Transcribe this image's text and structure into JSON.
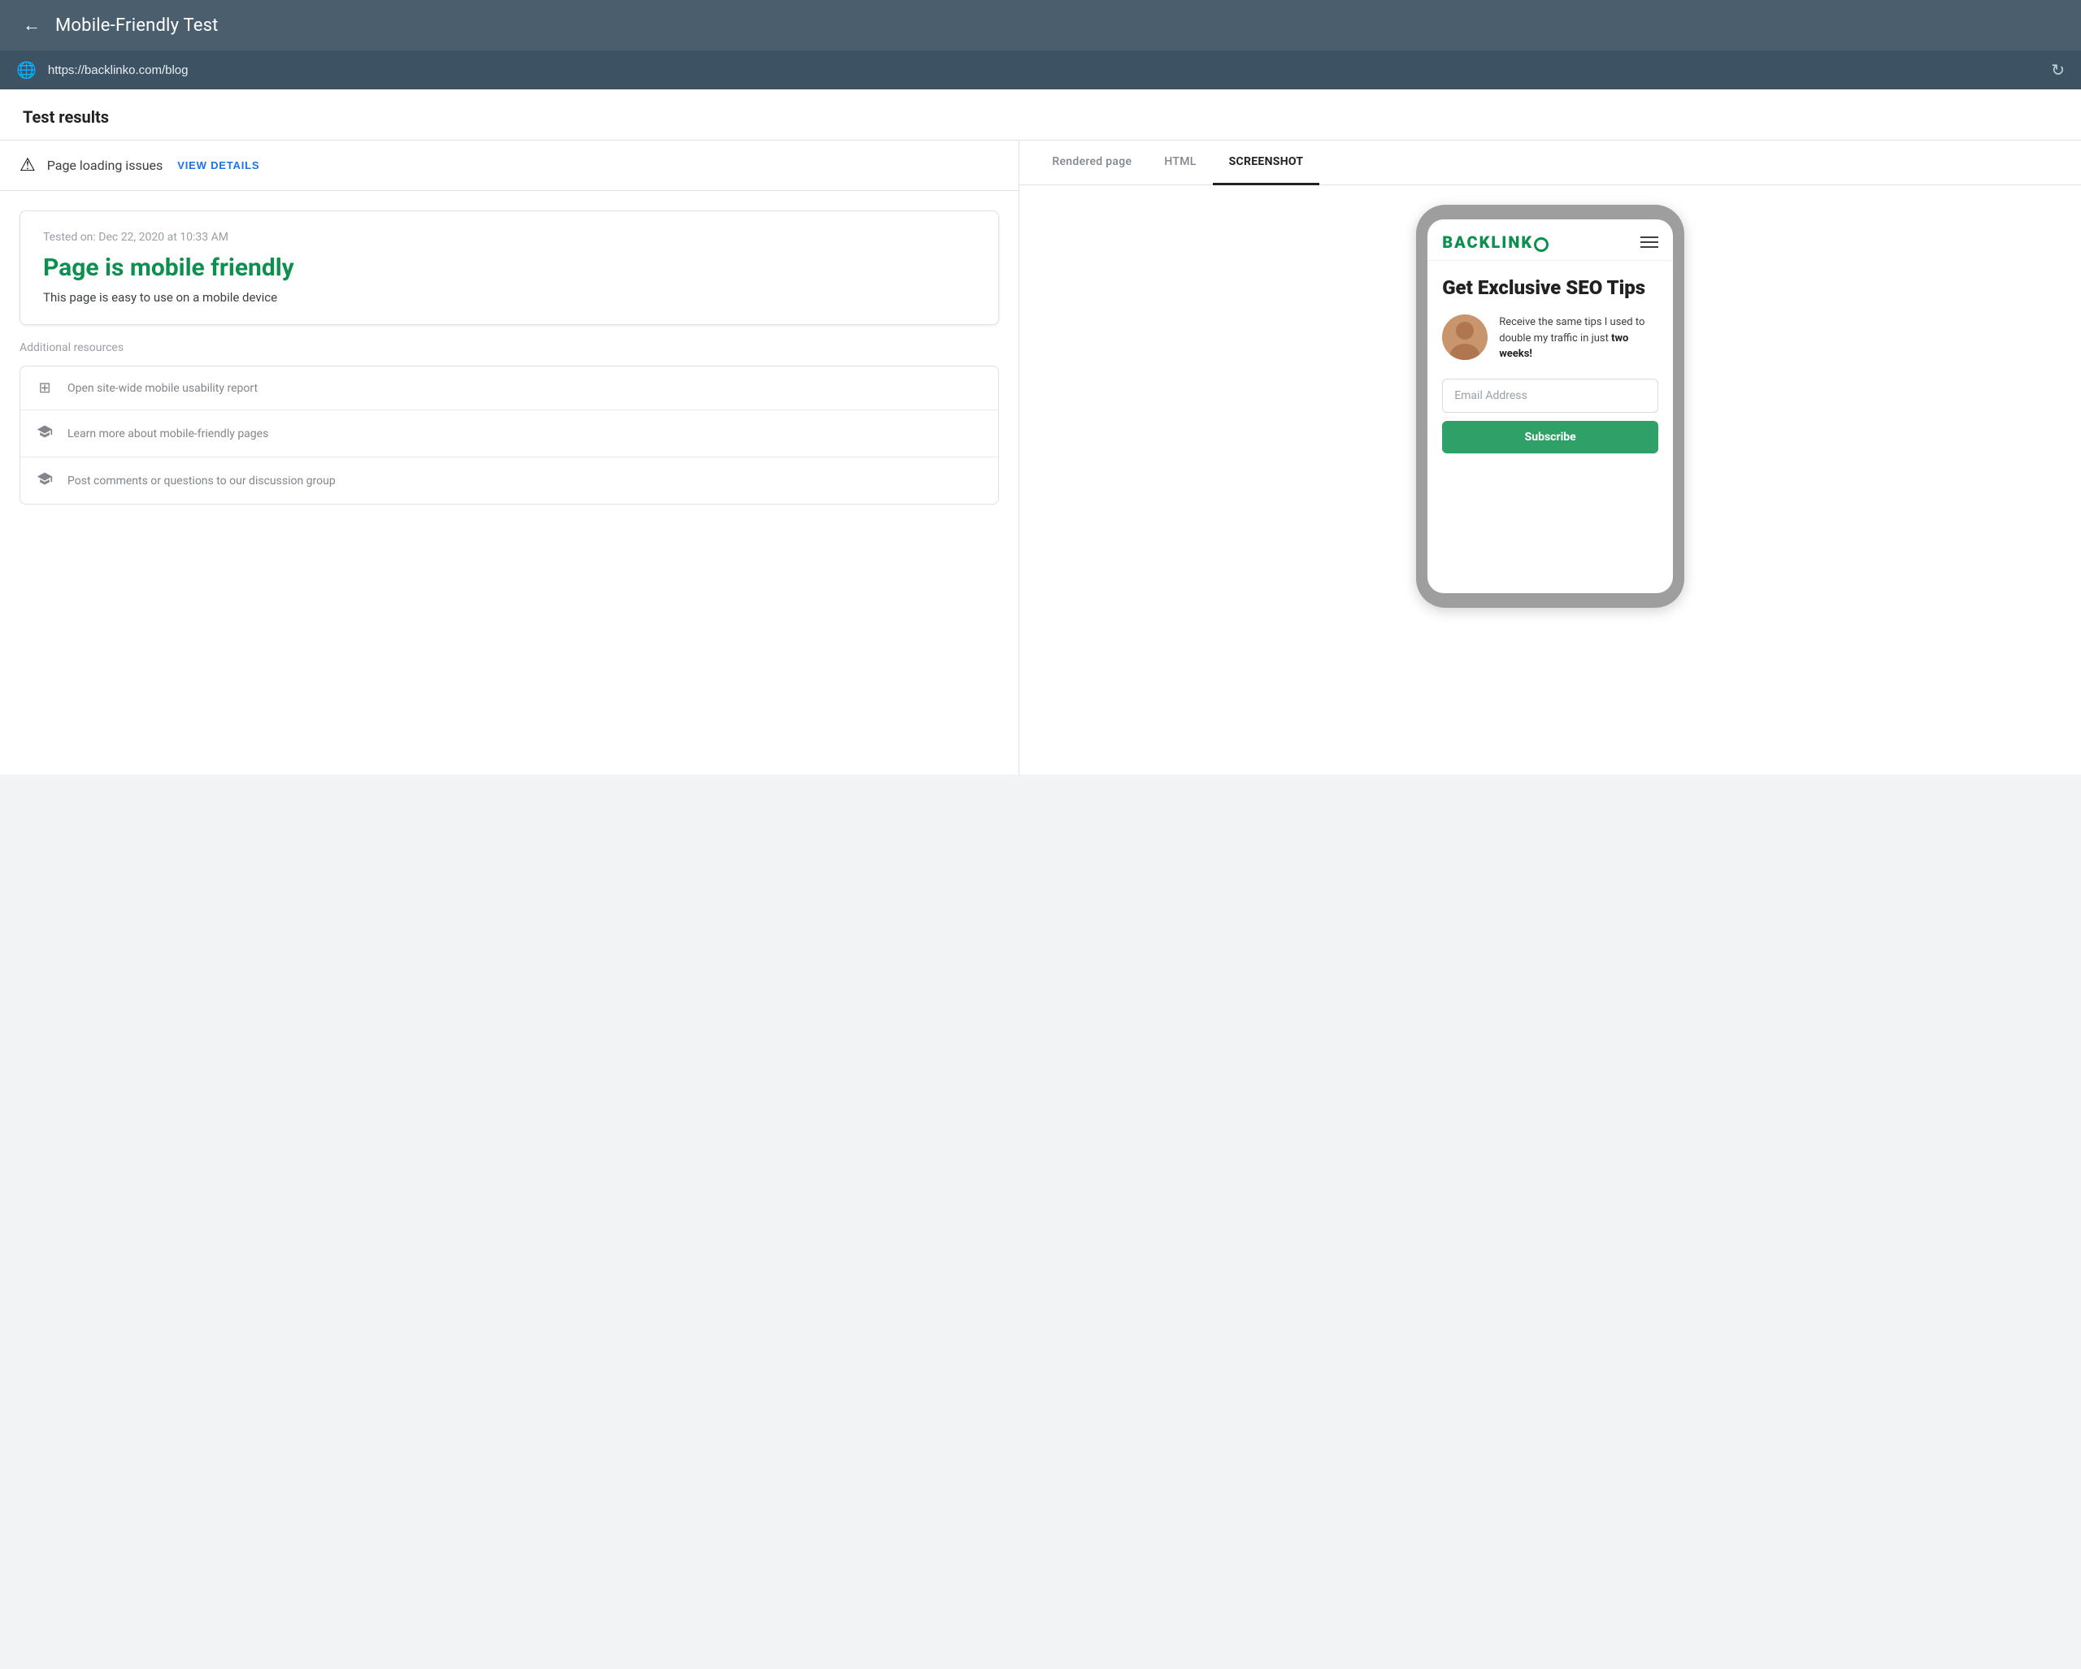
{
  "header": {
    "title": "Mobile-Friendly Test",
    "back_icon": "←",
    "url": "https://backlinko.com/blog",
    "refresh_icon": "↻"
  },
  "test_results_heading": "Test results",
  "warning": {
    "icon": "⚠",
    "text": "Page loading issues",
    "view_details_label": "VIEW DETAILS"
  },
  "result_card": {
    "date": "Tested on: Dec 22, 2020 at 10:33 AM",
    "status": "Page is mobile friendly",
    "description": "This page is easy to use on a mobile device"
  },
  "additional_resources": {
    "title": "Additional resources",
    "items": [
      {
        "icon": "▦",
        "text": "Open site-wide mobile usability report"
      },
      {
        "icon": "🎓",
        "text": "Learn more about mobile-friendly pages"
      },
      {
        "icon": "🎓",
        "text": "Post comments or questions to our discussion group"
      }
    ]
  },
  "tabs": [
    {
      "label": "Rendered page",
      "active": false
    },
    {
      "label": "HTML",
      "active": false
    },
    {
      "label": "SCREENSHOT",
      "active": true
    }
  ],
  "phone": {
    "logo_text": "BACKLINK",
    "headline": "Get Exclusive SEO Tips",
    "body_text_before": "Receive the same tips I used to double my traffic in just ",
    "body_text_bold": "two weeks!",
    "email_placeholder": "Email Address",
    "subscribe_button": "Subscribe"
  }
}
